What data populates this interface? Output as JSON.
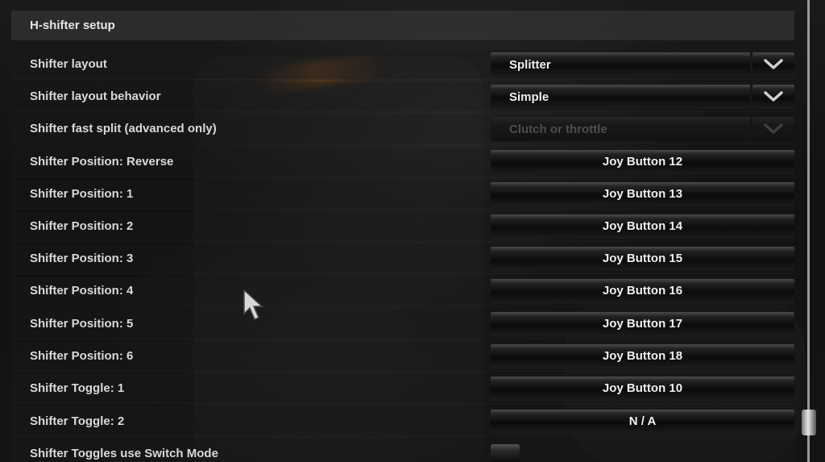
{
  "header": {
    "title": "H-shifter setup"
  },
  "rows": [
    {
      "label": "Shifter layout",
      "type": "dropdown",
      "value": "Splitter"
    },
    {
      "label": "Shifter layout behavior",
      "type": "dropdown",
      "value": "Simple"
    },
    {
      "label": "Shifter fast split (advanced only)",
      "type": "dropdown",
      "value": "Clutch or throttle",
      "disabled": true
    },
    {
      "label": "Shifter Position: Reverse",
      "type": "binding",
      "value": "Joy Button 12"
    },
    {
      "label": "Shifter Position: 1",
      "type": "binding",
      "value": "Joy Button 13"
    },
    {
      "label": "Shifter Position: 2",
      "type": "binding",
      "value": "Joy Button 14"
    },
    {
      "label": "Shifter Position: 3",
      "type": "binding",
      "value": "Joy Button 15"
    },
    {
      "label": "Shifter Position: 4",
      "type": "binding",
      "value": "Joy Button 16"
    },
    {
      "label": "Shifter Position: 5",
      "type": "binding",
      "value": "Joy Button 17"
    },
    {
      "label": "Shifter Position: 6",
      "type": "binding",
      "value": "Joy Button 18"
    },
    {
      "label": "Shifter Toggle: 1",
      "type": "binding",
      "value": "Joy Button 10"
    },
    {
      "label": "Shifter Toggle: 2",
      "type": "binding",
      "value": "N / A"
    },
    {
      "label": "Shifter Toggles use Switch Mode",
      "type": "checkbox",
      "checked": false
    }
  ],
  "icons": {
    "dropdown": "chevron-down-icon",
    "cursor": "mouse-pointer-icon"
  }
}
